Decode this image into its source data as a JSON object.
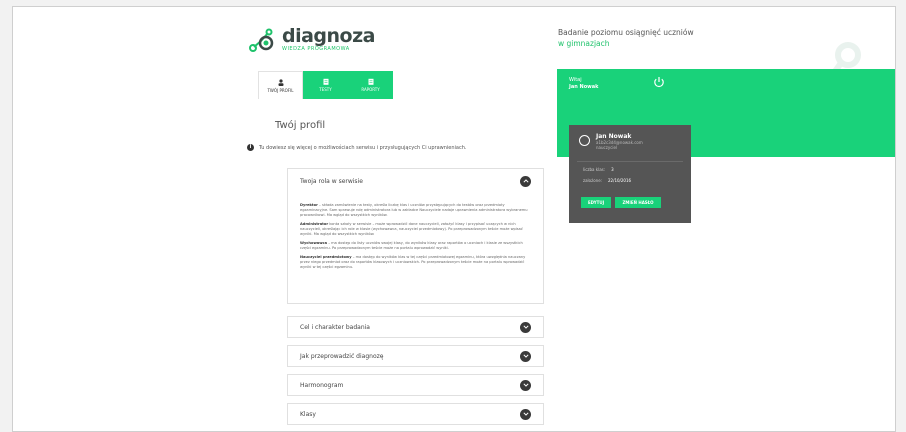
{
  "brand": {
    "name": "diagnoza",
    "subtitle": "WIEDZA PROGRAMOWA"
  },
  "header": {
    "tagline_line1": "Badanie poziomu osiągnięć uczniów",
    "tagline_line2": "w gimnazjach"
  },
  "topbar": {
    "greeting": "Witaj",
    "user": "Jan Nowak"
  },
  "tabs": [
    {
      "label": "TWÓJ PROFIL",
      "icon": "user-icon",
      "active": true
    },
    {
      "label": "TESTY",
      "icon": "clipboard-icon",
      "active": false
    },
    {
      "label": "RAPORTY",
      "icon": "report-icon",
      "active": false
    }
  ],
  "page": {
    "title": "Twój profil",
    "info": "Tu dowiesz się więcej o możliwościach serwisu i przysługujących Ci uprawnieniach."
  },
  "accordion_open": {
    "title": "Twoja rola w serwisie",
    "paragraphs": [
      {
        "lead": "Dyrektor",
        "text": " – składa zamówienie na testy, określa liczbę klas i uczniów przystępujących do testów oraz przedmioty egzaminacyjne. Sam sprawuje rolę administratora lub w zakładce Nauczyciele nadaje uprawnienia administratora wybranemu pracownikowi. Ma wgląd do wszystkich wyników."
      },
      {
        "lead": "Administrator",
        "text": " konta szkoły w serwisie – może wprowadzić dane nauczycieli, założyć klasy i przypisać uczących w nich nauczycieli, określając ich role w klasie (wychowawca, nauczyciel przedmiotowy). Po przeprowadzonym teście może wpisać wyniki. Ma wgląd do wszystkich wyników."
      },
      {
        "lead": "Wychowawca",
        "text": " – ma dostęp do listy uczniów swojej klasy, do wyników klasy oraz raportów o uczniach i klasie ze wszystkich części egzaminu. Po przeprowadzonym teście może na portalu wprowadzić wyniki."
      },
      {
        "lead": "Nauczyciel przedmiotowy",
        "text": " – ma dostęp do wyników klas w tej części przedmiotowej egzaminu, która uwzględnia nauczany przez niego przedmiot oraz do raportów klasowych i uczniowskich. Po przeprowadzonym teście może na portalu wprowadzić wyniki w tej części egzaminu."
      }
    ]
  },
  "accordions": [
    {
      "title": "Cel i charakter badania"
    },
    {
      "title": "Jak przeprowadzić diagnozę"
    },
    {
      "title": "Harmonogram"
    },
    {
      "title": "Klasy"
    }
  ],
  "profile_card": {
    "name": "Jan Nowak",
    "email": "a1b2c3d4@nowak.com",
    "role": "nauczyciel",
    "rows": [
      {
        "label": "liczba klas:",
        "value": "3"
      },
      {
        "label": "zalożone:",
        "value": "22/10/2016"
      }
    ],
    "edit_label": "EDYTUJ",
    "password_label": "ZMIEŃ HASŁO"
  },
  "colors": {
    "accent": "#19d27a",
    "card": "#555555",
    "dark": "#3a3a3a"
  }
}
